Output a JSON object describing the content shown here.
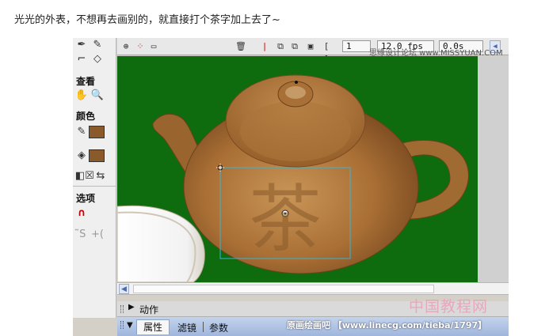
{
  "caption": "光光的外表，不想再去画别的，就直接打个茶字加上去了~",
  "tools": {
    "section_view": "查看",
    "section_color": "颜色",
    "section_options": "选项",
    "hand_icon": "✋",
    "zoom_icon": "🔍",
    "pencil_icon": "✎",
    "eraser_icon": "◇",
    "bucket_icon": "◈",
    "magnet_icon": "∩",
    "stroke_color": "#8b5a2b",
    "fill_color": "#8b5a2b",
    "smooth_labels": [
      " ˜S",
      "+("
    ]
  },
  "toolbar": {
    "frame_number": "1",
    "fps": "12.0 fps",
    "time": "0.0s",
    "trash_icon": "🗑"
  },
  "stage": {
    "background": "#0e6b0e",
    "character": "茶"
  },
  "panels": {
    "actions_label": "动作",
    "tab_properties": "属性",
    "tab_filters": "滤镜",
    "tab_parameters": "参数"
  },
  "watermarks": {
    "top_right": "思缘设计论坛 www.MISSYUAN.COM",
    "bottom_cn": "中国教程网",
    "bottom_url": "原画绘画吧 【www.linecg.com/tieba/1797】"
  }
}
